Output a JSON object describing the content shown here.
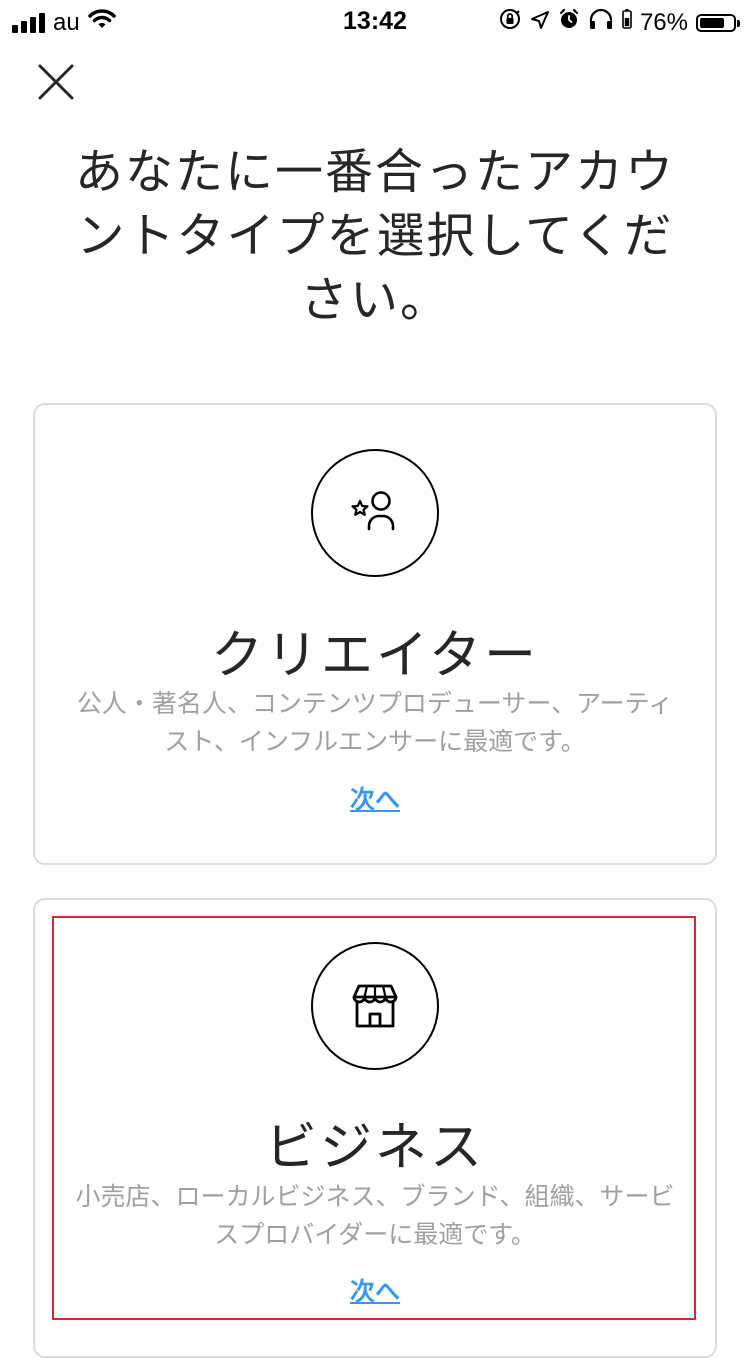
{
  "status_bar": {
    "carrier": "au",
    "time": "13:42",
    "battery_percent": "76%",
    "battery_level": 0.76,
    "icons": [
      "signal-icon",
      "wifi-icon",
      "rotation-lock-icon",
      "location-icon",
      "alarm-icon",
      "headphones-icon",
      "battery-icon"
    ]
  },
  "header": {
    "close_icon": "close-icon",
    "title": "あなたに一番合ったアカウントタイプを選択してください。"
  },
  "account_types": [
    {
      "icon": "creator-star-person-icon",
      "title": "クリエイター",
      "description": "公人・著名人、コンテンツプロデューサー、アーティスト、インフルエンサーに最適です。",
      "next_label": "次へ"
    },
    {
      "icon": "storefront-icon",
      "title": "ビジネス",
      "description": "小売店、ローカルビジネス、ブランド、組織、サービスプロバイダーに最適です。",
      "next_label": "次へ"
    }
  ],
  "colors": {
    "link": "#3897f0",
    "highlight": "#e0252a",
    "card_border": "#dbdbdb",
    "description_text": "#a0a0a0"
  }
}
